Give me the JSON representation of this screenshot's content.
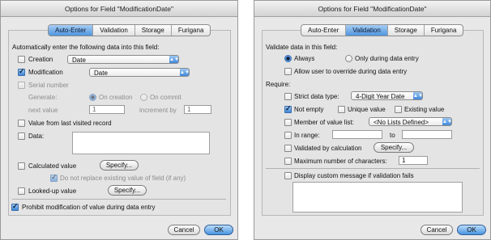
{
  "auto_enter_dialog": {
    "title": "Options for Field \"ModificationDate\"",
    "tabs": [
      "Auto-Enter",
      "Validation",
      "Storage",
      "Furigana"
    ],
    "active_tab": "Auto-Enter",
    "intro": "Automatically enter the following data into this field:",
    "creation": {
      "label": "Creation",
      "checked": false,
      "value": "Date"
    },
    "modification": {
      "label": "Modification",
      "checked": true,
      "value": "Date"
    },
    "serial": {
      "label": "Serial number",
      "checked": false,
      "generate_label": "Generate:",
      "on_creation": "On creation",
      "on_commit": "On commit",
      "next_value_label": "next value",
      "next_value": "1",
      "increment_label": "increment by",
      "increment": "1"
    },
    "last_visited": {
      "label": "Value from last visited record",
      "checked": false
    },
    "data": {
      "label": "Data:",
      "checked": false,
      "value": ""
    },
    "calculated": {
      "label": "Calculated value",
      "checked": false,
      "specify": "Specify...",
      "no_replace": "Do not replace existing value of field (if any)",
      "no_replace_checked": true
    },
    "looked_up": {
      "label": "Looked-up value",
      "checked": false,
      "specify": "Specify..."
    },
    "prohibit": {
      "label": "Prohibit modification of value during data entry",
      "checked": true
    },
    "cancel": "Cancel",
    "ok": "OK"
  },
  "validation_dialog": {
    "title": "Options for Field \"ModificationDate\"",
    "tabs": [
      "Auto-Enter",
      "Validation",
      "Storage",
      "Furigana"
    ],
    "active_tab": "Validation",
    "validate_label": "Validate data in this field:",
    "always": "Always",
    "only_during": "Only during data entry",
    "allow_override": "Allow user to override during data entry",
    "require_label": "Require:",
    "strict_type": {
      "label": "Strict data type:",
      "checked": false,
      "value": "4-Digit Year Date"
    },
    "not_empty": {
      "label": "Not empty",
      "checked": true
    },
    "unique": {
      "label": "Unique value",
      "checked": false
    },
    "existing": {
      "label": "Existing value",
      "checked": false
    },
    "member_list": {
      "label": "Member of value list:",
      "checked": false,
      "value": "<No Lists Defined>"
    },
    "in_range": {
      "label": "In range:",
      "checked": false,
      "to_label": "to",
      "from": "",
      "to": ""
    },
    "by_calc": {
      "label": "Validated by calculation",
      "checked": false,
      "specify": "Specify..."
    },
    "max_chars": {
      "label": "Maximum number of characters:",
      "checked": false,
      "value": "1"
    },
    "custom_message": {
      "label": "Display custom message if validation fails",
      "checked": false,
      "value": ""
    },
    "cancel": "Cancel",
    "ok": "OK"
  },
  "colors": {
    "accent": "#4f95df",
    "window_bg": "#e8e8e8"
  }
}
